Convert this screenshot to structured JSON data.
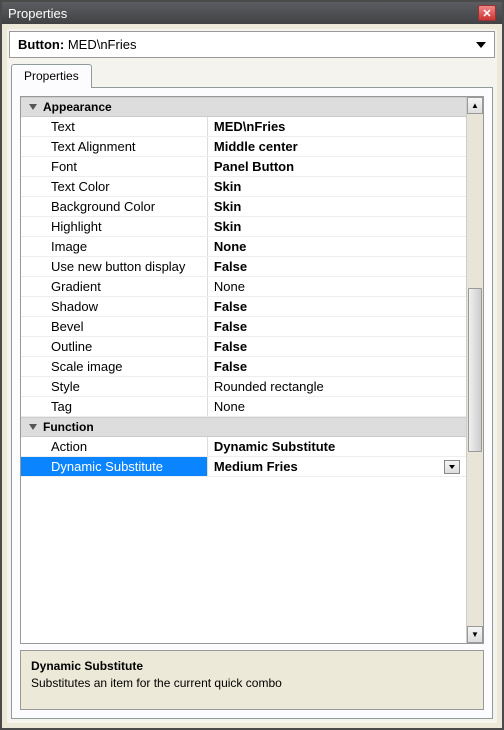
{
  "title": "Properties",
  "header_label": "Button:",
  "header_value": "MED\\nFries",
  "tab": "Properties",
  "categories": [
    {
      "name": "Appearance",
      "rows": [
        {
          "label": "Text",
          "value": "MED\\nFries",
          "bold": true
        },
        {
          "label": "Text Alignment",
          "value": "Middle center",
          "bold": true
        },
        {
          "label": "Font",
          "value": "Panel Button",
          "bold": true
        },
        {
          "label": "Text Color",
          "value": "Skin",
          "bold": true
        },
        {
          "label": "Background Color",
          "value": "Skin",
          "bold": true
        },
        {
          "label": "Highlight",
          "value": "Skin",
          "bold": true
        },
        {
          "label": "Image",
          "value": "None",
          "bold": true
        },
        {
          "label": "Use new button display",
          "value": "False",
          "bold": true
        },
        {
          "label": "Gradient",
          "value": "None",
          "bold": false
        },
        {
          "label": "Shadow",
          "value": "False",
          "bold": true
        },
        {
          "label": "Bevel",
          "value": "False",
          "bold": true
        },
        {
          "label": "Outline",
          "value": "False",
          "bold": true
        },
        {
          "label": "Scale image",
          "value": "False",
          "bold": true
        },
        {
          "label": "Style",
          "value": "Rounded rectangle",
          "bold": false
        },
        {
          "label": "Tag",
          "value": "None",
          "bold": false
        }
      ]
    },
    {
      "name": "Function",
      "rows": [
        {
          "label": "Action",
          "value": "Dynamic Substitute",
          "bold": true
        },
        {
          "label": "Dynamic Substitute",
          "value": "Medium Fries",
          "bold": true,
          "selected": true,
          "dropdown": true
        }
      ]
    }
  ],
  "desc_title": "Dynamic Substitute",
  "desc_text": "Substitutes an item for the current quick combo"
}
